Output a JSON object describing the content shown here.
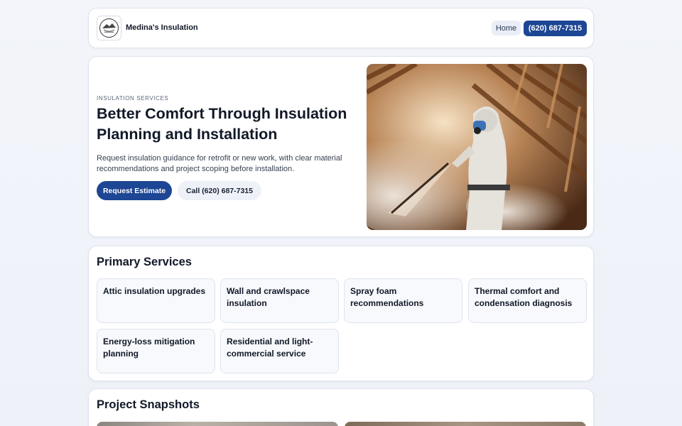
{
  "header": {
    "brand_name": "Medina's Insulation",
    "logo_icon": "house-logo-icon",
    "nav_home": "Home",
    "nav_phone": "(620) 687-7315"
  },
  "hero": {
    "eyebrow": "INSULATION SERVICES",
    "title": "Better Comfort Through Insulation Planning and Installation",
    "description": "Request insulation guidance for retrofit or new work, with clear material recommendations and project scoping before installation.",
    "primary_button": "Request Estimate",
    "secondary_button": "Call (620) 687-7315",
    "image_icon": "spray-foam-worker-photo"
  },
  "services": {
    "title": "Primary Services",
    "items": [
      "Attic insulation upgrades",
      "Wall and crawlspace insulation",
      "Spray foam recommendations",
      "Thermal comfort and condensation diagnosis",
      "Energy-loss mitigation planning",
      "Residential and light-commercial service"
    ]
  },
  "snapshots": {
    "title": "Project Snapshots"
  },
  "colors": {
    "accent": "#1d4694",
    "background": "#f1f4fa",
    "card": "#ffffff"
  }
}
